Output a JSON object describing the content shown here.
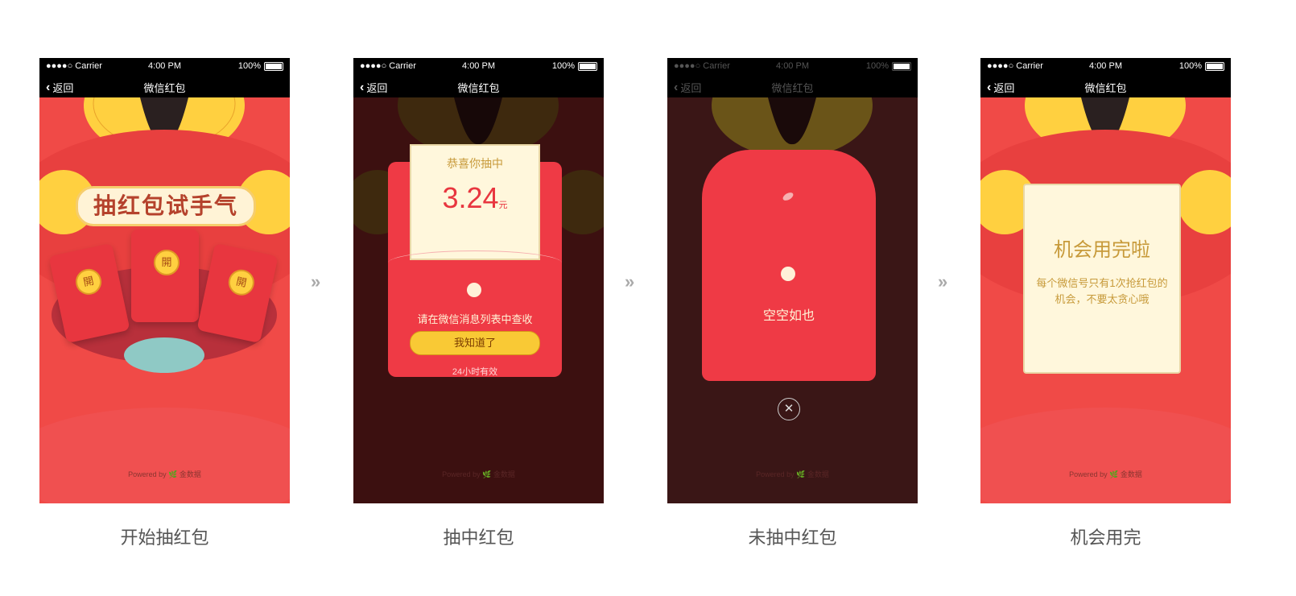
{
  "status": {
    "signal": "●●●●○ Carrier",
    "time": "4:00 PM",
    "battery": "100%"
  },
  "nav": {
    "back": "返回",
    "title": "微信红包"
  },
  "powered": "Powered by 🌿 金数据",
  "screens": {
    "start": {
      "banner": "抽红包试手气",
      "open": "開",
      "caption": "开始抽红包"
    },
    "win": {
      "congrats": "恭喜你抽中",
      "amount": "3.24",
      "unit": "元",
      "note": "请在微信消息列表中查收",
      "ok": "我知道了",
      "valid": "24小时有效",
      "caption": "抽中红包"
    },
    "lose": {
      "text": "空空如也",
      "close": "✕",
      "caption": "未抽中红包"
    },
    "used": {
      "title": "机会用完啦",
      "desc": "每个微信号只有1次抢红包的机会，不要太贪心哦",
      "caption": "机会用完"
    }
  },
  "arrow": "»",
  "colors": {
    "red": "#f04a47",
    "yellow": "#ffd040",
    "gold": "#c79a3a"
  }
}
